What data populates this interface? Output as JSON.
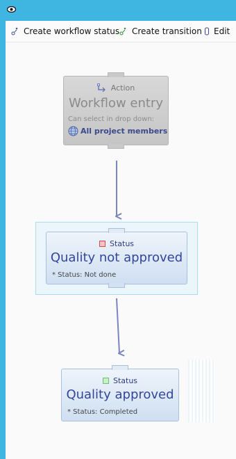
{
  "toolbar": {
    "create_status": "Create workflow status",
    "create_transition": "Create transition",
    "edit": "Edit"
  },
  "nodes": {
    "entry": {
      "kind": "Action",
      "title": "Workflow entry",
      "hint": "Can select in drop down:",
      "members": "All project members"
    },
    "not_approved": {
      "kind": "Status",
      "title": "Quality not approved",
      "detail": "* Status: Not done",
      "color": "#e06a6a"
    },
    "approved": {
      "kind": "Status",
      "title": "Quality approved",
      "detail": "* Status: Completed",
      "color": "#8fd68f"
    }
  },
  "colors": {
    "accent": "#3fb6e2",
    "arrow": "#7b84c0"
  }
}
